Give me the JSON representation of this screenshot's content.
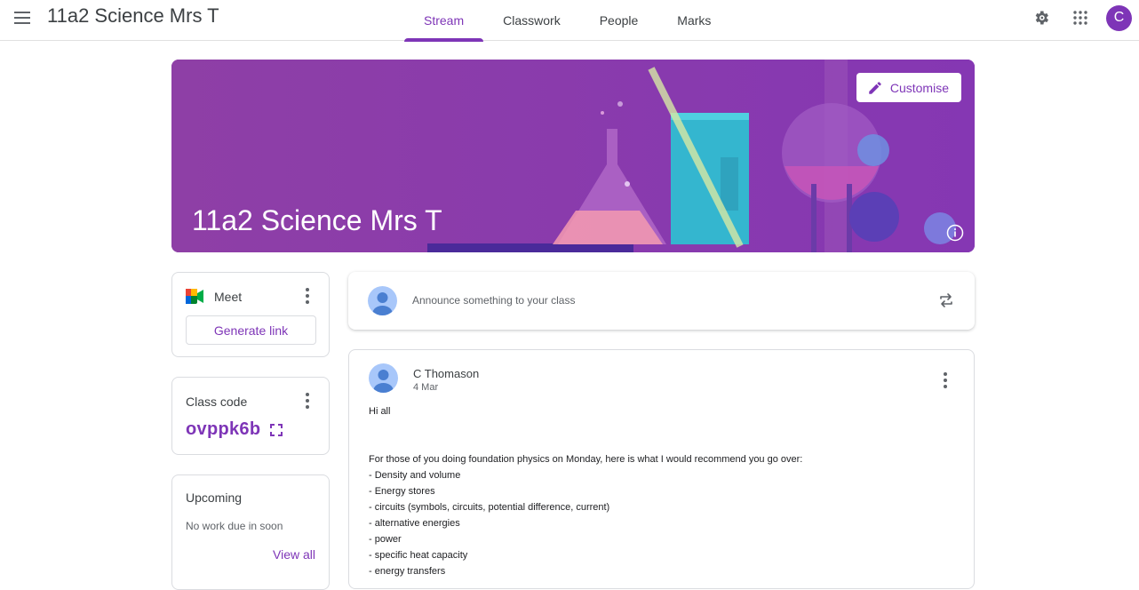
{
  "app": {
    "title": "11a2 Science Mrs T"
  },
  "tabs": [
    {
      "label": "Stream",
      "active": true
    },
    {
      "label": "Classwork",
      "active": false
    },
    {
      "label": "People",
      "active": false
    },
    {
      "label": "Marks",
      "active": false
    }
  ],
  "top_icons": [
    "gear-icon",
    "apps-grid-icon"
  ],
  "user": {
    "initial": "C"
  },
  "banner": {
    "title": "11a2 Science Mrs T",
    "customise_label": "Customise"
  },
  "meet": {
    "title": "Meet",
    "generate_label": "Generate link"
  },
  "class_code": {
    "label": "Class code",
    "value": "ovppk6b"
  },
  "upcoming": {
    "title": "Upcoming",
    "subtitle": "No work due in soon",
    "view_all": "View all"
  },
  "announce": {
    "placeholder": "Announce something to your class"
  },
  "post": {
    "author": "C Thomason",
    "date": "4 Mar",
    "greeting": "Hi all",
    "intro": "For those of you doing foundation physics on Monday, here is what I would recommend you go over:",
    "items": [
      "- Density and volume",
      "- Energy stores",
      "- circuits (symbols, circuits, potential difference, current)",
      "- alternative energies",
      "- power",
      "- specific heat capacity",
      "- energy transfers"
    ]
  },
  "colors": {
    "accent": "#7e35b7",
    "banner": "#8a3fab"
  }
}
